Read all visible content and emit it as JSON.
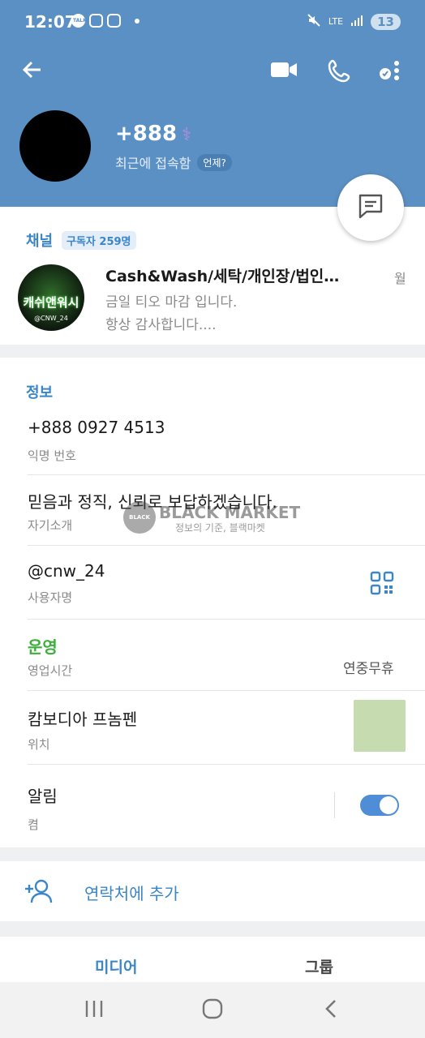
{
  "status_bar": {
    "time": "12:07",
    "notif_talk": "TALK",
    "signal": "LTE",
    "battery": "13"
  },
  "header": {
    "back_icon": "arrow-left-icon",
    "video_icon": "video-camera-icon",
    "call_icon": "phone-icon",
    "more_icon": "more-vertical-icon",
    "name": "+888",
    "status": "최근에 접속함",
    "when_badge": "언제?"
  },
  "fab": {
    "icon": "message-icon"
  },
  "channel": {
    "label": "채널",
    "subscribers": "구독자 259명",
    "avatar_text": "캐쉬앤워시",
    "avatar_handle": "@CNW_24",
    "title": "Cash&Wash/세탁/개인장/법인…",
    "date": "월",
    "line1": "금일 티오 마감 입니다.",
    "line2": "항상 감사합니다...."
  },
  "info": {
    "label": "정보",
    "phone": "+888 0927 4513",
    "phone_sub": "익명 번호",
    "bio": "믿음과 정직, 신뢰로 보답하겠습니다.",
    "bio_sub": "자기소개",
    "username": "@cnw_24",
    "username_sub": "사용자명",
    "business_status": "운영",
    "business_hours_sub": "영업시간",
    "business_hours_value": "연중무휴",
    "location": "캄보디아 프놈펜",
    "location_sub": "위치",
    "notifications": "알림",
    "notifications_sub": "켬",
    "notifications_on": true
  },
  "watermark": {
    "title": "BLACK MARKET",
    "subtitle": "정보의 기준, 블랙마켓",
    "logo_text": "BLACK MARKET"
  },
  "actions": {
    "add_contact": "연락처에 추가"
  },
  "tabs": {
    "media": "미디어",
    "groups": "그룹"
  },
  "colors": {
    "header": "#5a90c4",
    "accent": "#3a86c8",
    "green": "#3cae3c"
  }
}
